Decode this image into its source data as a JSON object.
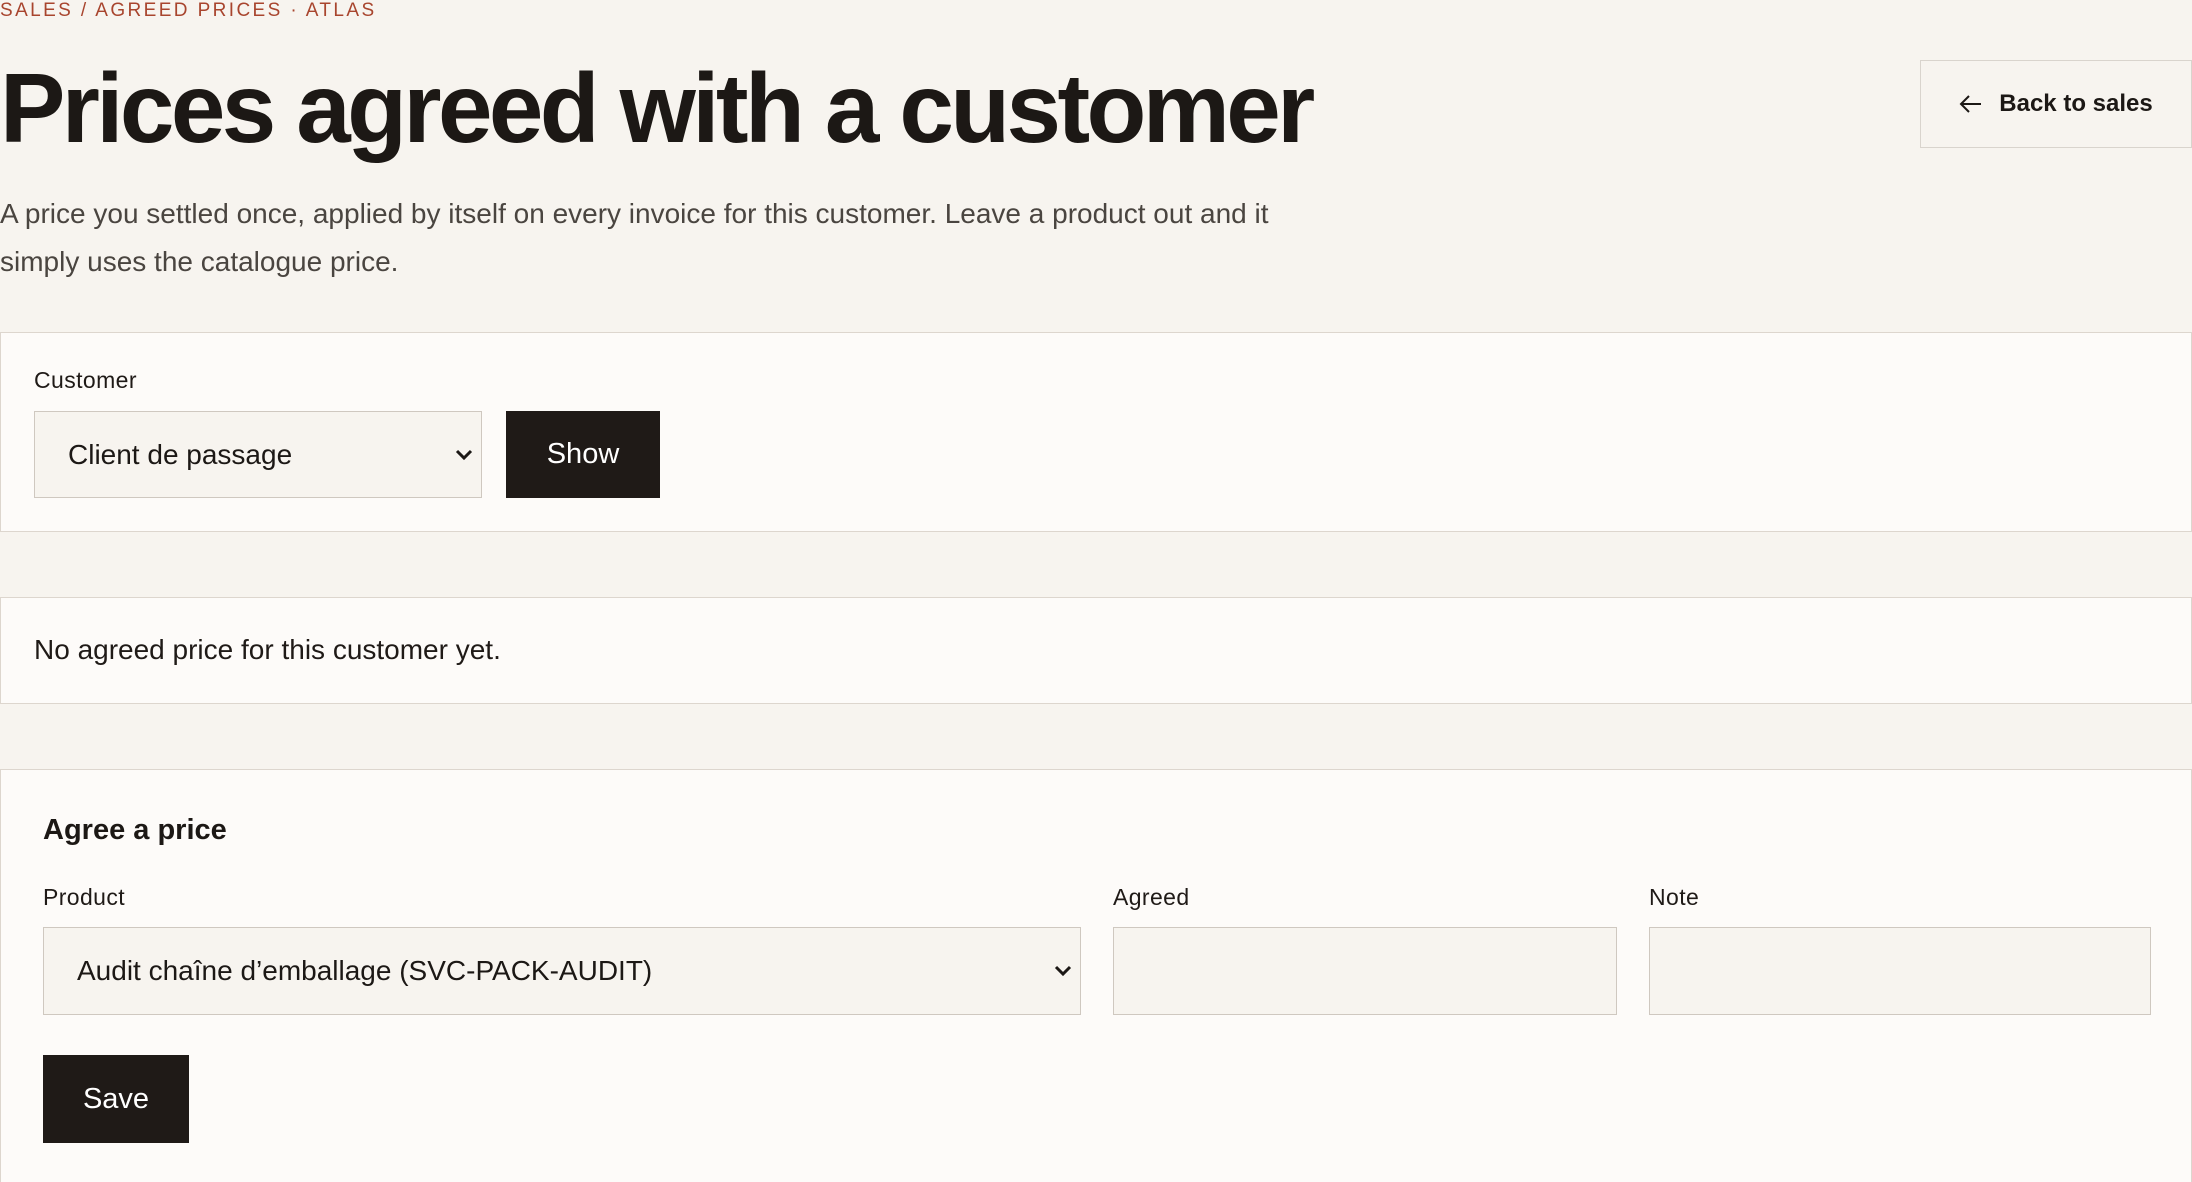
{
  "breadcrumb": "SALES / AGREED PRICES · ATLAS",
  "page_title": "Prices agreed with a customer",
  "back_button_label": "Back to sales",
  "intro_text": "A price you settled once, applied by itself on every invoice for this customer. Leave a product out and it simply uses the catalogue price.",
  "customer_filter": {
    "label": "Customer",
    "selected": "Client de passage",
    "show_button": "Show"
  },
  "empty_message": "No agreed price for this customer yet.",
  "agree_form": {
    "title": "Agree a price",
    "product_label": "Product",
    "product_selected": "Audit chaîne d’emballage (SVC-PACK-AUDIT)",
    "agreed_label": "Agreed",
    "agreed_value": "",
    "note_label": "Note",
    "note_value": "",
    "save_button": "Save"
  },
  "icons": {
    "back": "arrow-left-icon",
    "dropdown": "chevron-down-icon"
  },
  "colors": {
    "background": "#f7f4ef",
    "card": "#fdfbf9",
    "accent": "#a8452e",
    "dark_button": "#1f1a17"
  }
}
